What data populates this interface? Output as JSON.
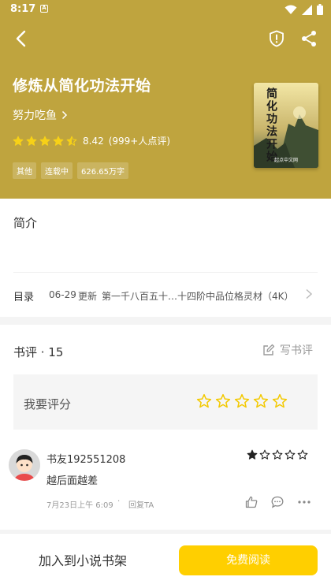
{
  "status_bar": {
    "time": "8:17",
    "notification_glyph": "A"
  },
  "book": {
    "title": "修炼从简化功法开始",
    "author": "努力吃鱼",
    "rating_score": "8.42",
    "rating_count": "(999+人点评)",
    "rating_stars": 4.5,
    "tags": [
      "其他",
      "连载中",
      "626.65万字"
    ],
    "cover_title": "简化功法开始",
    "cover_publisher": "起点中文网"
  },
  "intro": {
    "label": "简介",
    "text": ""
  },
  "toc": {
    "label": "目录",
    "date": "06-29",
    "updated": "更新",
    "latest_chapter": "第一千八百五十…十四阶中品位格灵材（4K）"
  },
  "reviews": {
    "label": "书评 · 15",
    "write_label": "写书评",
    "rate_label": "我要评分",
    "items": [
      {
        "name": "书友192551208",
        "stars": 1,
        "text": "越后面越差",
        "time": "7月23日上午 6:09",
        "dot": "·",
        "reply": "回复TA"
      }
    ]
  },
  "bottom": {
    "shelf_label": "加入到小说书架",
    "read_label": "免费阅读"
  },
  "colors": {
    "header": "#bfa43e",
    "accent": "#ffcf00",
    "star_header": "#f7d117",
    "star_rate": "#f3c900"
  },
  "icons": [
    "back-arrow-icon",
    "shield-icon",
    "share-icon",
    "chevron-right-icon",
    "star-icon",
    "edit-icon",
    "thumbs-up-icon",
    "comment-icon",
    "more-icon",
    "wifi-icon",
    "signal-icon",
    "battery-icon"
  ]
}
